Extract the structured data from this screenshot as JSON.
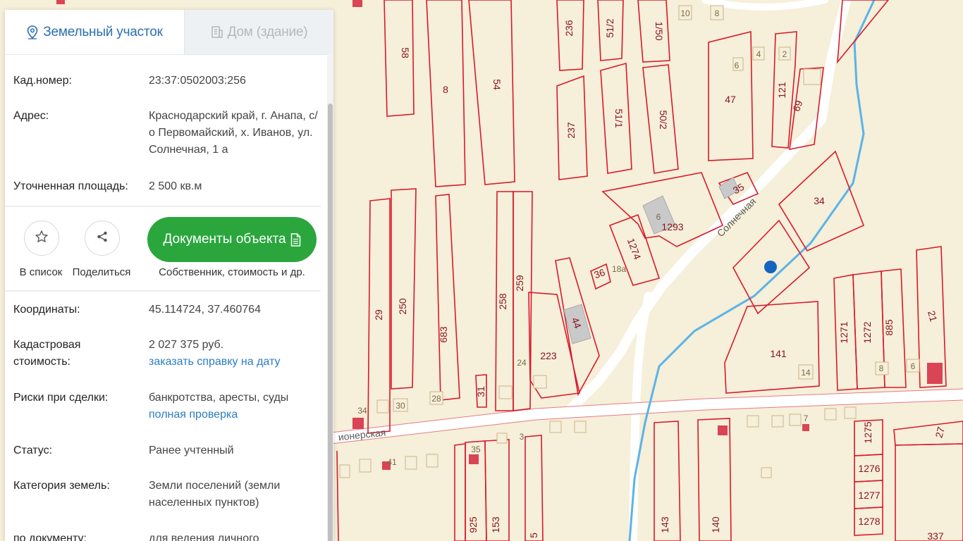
{
  "tabs": {
    "land": "Земельный участок",
    "house": "Дом (здание)"
  },
  "info": {
    "cad_label": "Кад.номер:",
    "cad_value": "23:37:0502003:256",
    "address_label": "Адрес:",
    "address_value": "Краснодарский край, г. Анапа, с/о Первомайский, х. Иванов, ул. Солнечная, 1 а",
    "area_label": "Уточненная площадь:",
    "area_value": "2 500 кв.м"
  },
  "actions": {
    "favorite_label": "В список",
    "share_label": "Поделиться",
    "documents_button": "Документы объекта",
    "documents_sub": "Собственник, стоимость и др."
  },
  "details": {
    "coords_label": "Координаты:",
    "coords_value": "45.114724, 37.460764",
    "cost_label": "Кадастровая стоимость:",
    "cost_value": "2 027 375 руб.",
    "cost_link": "заказать справку на дату",
    "risks_label": "Риски при сделки:",
    "risks_value": "банкротства, аресты, суды",
    "risks_link": "полная проверка",
    "status_label": "Статус:",
    "status_value": "Ранее учтенный",
    "category_label": "Категория земель:",
    "category_value": "Земли поселений (земли населенных пунктов)",
    "usage_label": "по документу:",
    "usage_value": "для ведения личного подсобного"
  },
  "map": {
    "streets": [
      "Солнечная",
      "ионерская"
    ],
    "parcel_numbers": [
      "58",
      "8",
      "54",
      "236",
      "51/2",
      "1/50",
      "237",
      "51/1",
      "50/2",
      "47",
      "121",
      "69",
      "34",
      "35",
      "1293",
      "1274",
      "36",
      "44",
      "223",
      "259",
      "258",
      "683",
      "250",
      "29",
      "31",
      "141",
      "1271",
      "1272",
      "885",
      "21",
      "1275",
      "1276",
      "1277",
      "1278",
      "27",
      "337",
      "925",
      "153",
      "5",
      "143",
      "140"
    ],
    "house_numbers": [
      "10",
      "8",
      "6",
      "4",
      "2",
      "6",
      "18а",
      "24",
      "30",
      "28",
      "34",
      "14",
      "8",
      "6",
      "35",
      "3",
      "41",
      "7"
    ],
    "colors": {
      "background": "#f6efd9",
      "parcel_border": "#d8192c",
      "river": "#5ab4e8",
      "marker": "#1565c0",
      "button_green": "#2aa63d",
      "link_blue": "#2b7cc4"
    }
  }
}
